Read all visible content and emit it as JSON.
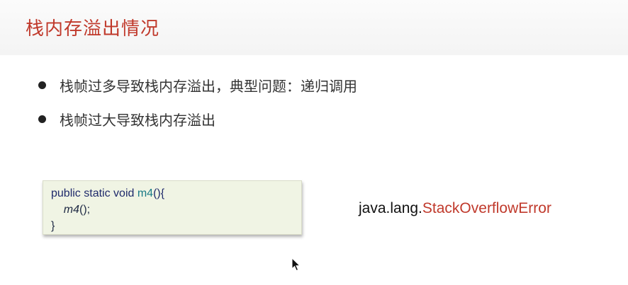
{
  "slide": {
    "title": "栈内存溢出情况",
    "bullets": [
      "栈帧过多导致栈内存溢出，典型问题：递归调用",
      "栈帧过大导致栈内存溢出"
    ],
    "code": {
      "line1_keywords": "public static void ",
      "line1_method": "m4",
      "line1_tail": "(){",
      "line2_indent": "    ",
      "line2_call": "m4",
      "line2_tail": "();",
      "line3": "}"
    },
    "error": {
      "package": "java.lang.",
      "class": "StackOverflowError"
    }
  },
  "colors": {
    "title": "#c0392b",
    "error_class": "#c0392b",
    "code_background": "#f0f4e4"
  },
  "icons": {
    "bullet": "bullet-dot-icon",
    "cursor": "mouse-pointer-icon"
  }
}
